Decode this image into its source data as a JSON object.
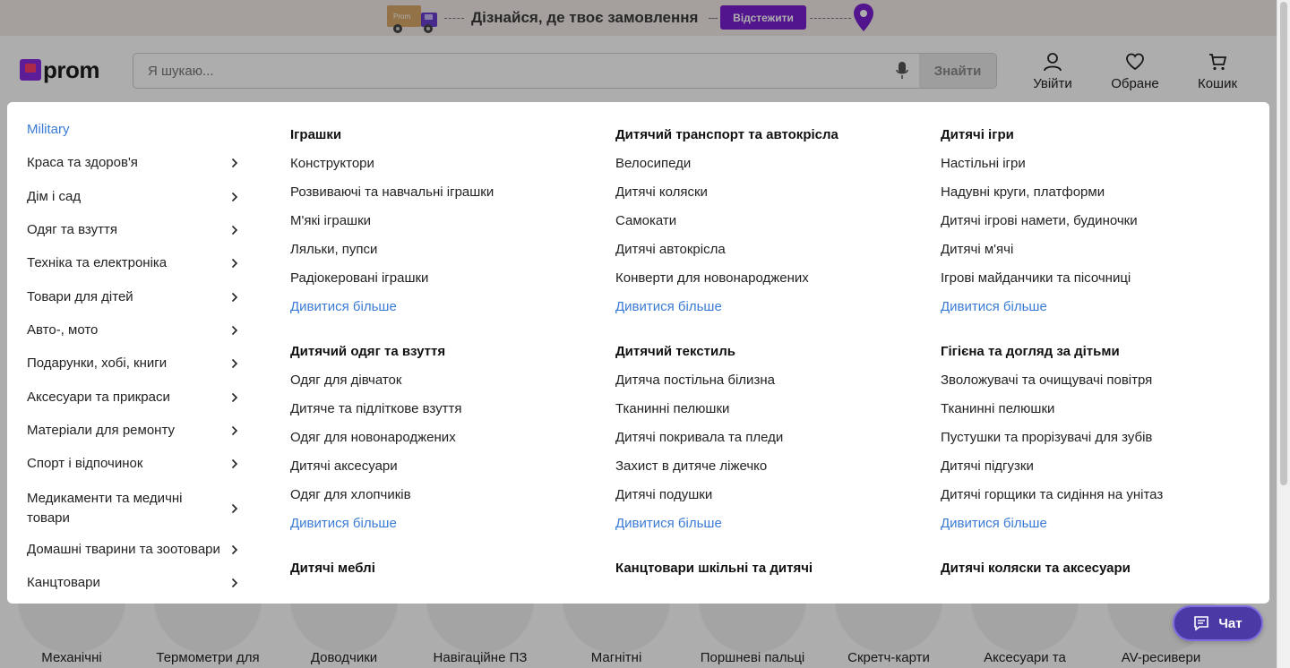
{
  "promo": {
    "text": "Дізнайся, де твоє замовлення",
    "button": "Відстежити",
    "truck_label": "Prom"
  },
  "header": {
    "logo": "prom",
    "search_placeholder": "Я шукаю...",
    "search_button": "Знайти",
    "login": "Увійти",
    "favorites": "Обране",
    "cart": "Кошик"
  },
  "categories": [
    {
      "label": "Military",
      "active": true
    },
    {
      "label": "Краса та здоров'я"
    },
    {
      "label": "Дім і сад"
    },
    {
      "label": "Одяг та взуття"
    },
    {
      "label": "Техніка та електроніка"
    },
    {
      "label": "Товари для дітей"
    },
    {
      "label": "Авто-, мото"
    },
    {
      "label": "Подарунки, хобі, книги"
    },
    {
      "label": "Аксесуари та прикраси"
    },
    {
      "label": "Матеріали для ремонту"
    },
    {
      "label": "Спорт і відпочинок"
    },
    {
      "label": "Медикаменти та медичні товари"
    },
    {
      "label": "Домашні тварини та зоотовари"
    },
    {
      "label": "Канцтовари"
    }
  ],
  "subgroups": {
    "col1": [
      {
        "title": "Іграшки",
        "items": [
          "Конструктори",
          "Розвиваючі та навчальні іграшки",
          "М'які іграшки",
          "Ляльки, пупси",
          "Радіокеровані іграшки"
        ],
        "more": "Дивитися більше"
      },
      {
        "title": "Дитячий одяг та взуття",
        "items": [
          "Одяг для дівчаток",
          "Дитяче та підліткове взуття",
          "Одяг для новонароджених",
          "Дитячі аксесуари",
          "Одяг для хлопчиків"
        ],
        "more": "Дивитися більше"
      },
      {
        "title": "Дитячі меблі",
        "items": [],
        "more": ""
      }
    ],
    "col2": [
      {
        "title": "Дитячий транспорт та автокрісла",
        "items": [
          "Велосипеди",
          "Дитячі коляски",
          "Самокати",
          "Дитячі автокрісла",
          "Конверти для новонароджених"
        ],
        "more": "Дивитися більше"
      },
      {
        "title": "Дитячий текстиль",
        "items": [
          "Дитяча постільна білизна",
          "Тканинні пелюшки",
          "Дитячі покривала та пледи",
          "Захист в дитяче ліжечко",
          "Дитячі подушки"
        ],
        "more": "Дивитися більше"
      },
      {
        "title": "Канцтовари шкільні та дитячі",
        "items": [],
        "more": ""
      }
    ],
    "col3": [
      {
        "title": "Дитячі ігри",
        "items": [
          "Настільні ігри",
          "Надувні круги, платформи",
          "Дитячі ігрові намети, будиночки",
          "Дитячі м'ячі",
          "Ігрові майданчики та пісочниці"
        ],
        "more": "Дивитися більше"
      },
      {
        "title": "Гігієна та догляд за дітьми",
        "items": [
          "Зволожувачі та очищувачі повітря",
          "Тканинні пелюшки",
          "Пустушки та прорізувачі для зубів",
          "Дитячі підгузки",
          "Дитячі горщики та сидіння на унітаз"
        ],
        "more": "Дивитися більше"
      },
      {
        "title": "Дитячі коляски та аксесуари",
        "items": [],
        "more": ""
      }
    ]
  },
  "background_cards": [
    "Механічні",
    "Термометри для",
    "Доводчики",
    "Навігаційне ПЗ",
    "Магнітні",
    "Поршневі пальці",
    "Скретч-карти",
    "Аксесуари та",
    "AV-ресивери"
  ],
  "chat": {
    "label": "Чат"
  },
  "colors": {
    "accent": "#7a1fd1",
    "link": "#3a7bd5",
    "chat": "#4b3aa6"
  }
}
